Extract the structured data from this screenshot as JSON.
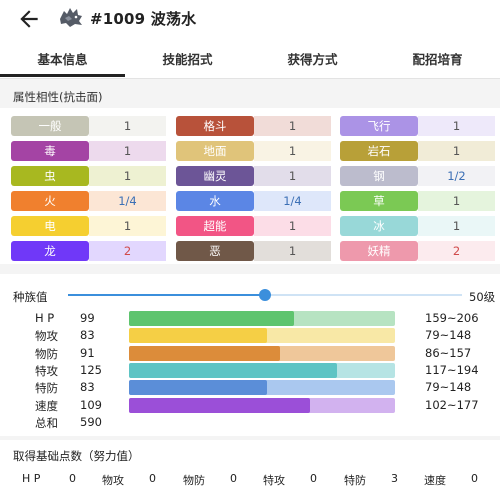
{
  "header": {
    "title": "#1009 波荡水"
  },
  "tabs": [
    {
      "label": "基本信息",
      "active": true
    },
    {
      "label": "技能招式",
      "active": false
    },
    {
      "label": "获得方式",
      "active": false
    },
    {
      "label": "配招培育",
      "active": false
    }
  ],
  "type_effectiveness": {
    "title": "属性相性(抗击面)",
    "items": [
      {
        "type": "一般",
        "mult": "1",
        "color": "#c5c5b5",
        "mult_color": "#555555"
      },
      {
        "type": "格斗",
        "mult": "1",
        "color": "#b8523a",
        "mult_color": "#555555"
      },
      {
        "type": "飞行",
        "mult": "1",
        "color": "#ab93e6",
        "mult_color": "#555555"
      },
      {
        "type": "毒",
        "mult": "1",
        "color": "#a444a4",
        "mult_color": "#555555"
      },
      {
        "type": "地面",
        "mult": "1",
        "color": "#e0c47a",
        "mult_color": "#555555"
      },
      {
        "type": "岩石",
        "mult": "1",
        "color": "#b8a038",
        "mult_color": "#555555"
      },
      {
        "type": "虫",
        "mult": "1",
        "color": "#a8b820",
        "mult_color": "#555555"
      },
      {
        "type": "幽灵",
        "mult": "1",
        "color": "#6c5597",
        "mult_color": "#555555"
      },
      {
        "type": "钢",
        "mult": "1/2",
        "color": "#bcbccd",
        "mult_color": "#3b6fb5"
      },
      {
        "type": "火",
        "mult": "1/4",
        "color": "#f0802e",
        "mult_color": "#3b6fb5"
      },
      {
        "type": "水",
        "mult": "1/4",
        "color": "#5b86e5",
        "mult_color": "#3b6fb5"
      },
      {
        "type": "草",
        "mult": "1",
        "color": "#7bc954",
        "mult_color": "#555555"
      },
      {
        "type": "电",
        "mult": "1",
        "color": "#f5cf30",
        "mult_color": "#555555"
      },
      {
        "type": "超能",
        "mult": "1",
        "color": "#f25585",
        "mult_color": "#555555"
      },
      {
        "type": "冰",
        "mult": "1",
        "color": "#98d8d8",
        "mult_color": "#555555"
      },
      {
        "type": "龙",
        "mult": "2",
        "color": "#7038f8",
        "mult_color": "#d04a4a"
      },
      {
        "type": "恶",
        "mult": "1",
        "color": "#705848",
        "mult_color": "#555555"
      },
      {
        "type": "妖精",
        "mult": "2",
        "color": "#ee99ac",
        "mult_color": "#d04a4a"
      }
    ]
  },
  "base_stats": {
    "label": "种族值",
    "level_label": "50级",
    "level_fraction": 0.5,
    "max_scale": 160,
    "rows": [
      {
        "name": "H P",
        "value": "99",
        "range": "159~206",
        "fill": "#5ec46e",
        "bg": "#b7e3c2"
      },
      {
        "name": "物攻",
        "value": "83",
        "range": "79~148",
        "fill": "#f5cf45",
        "bg": "#f8e8a6"
      },
      {
        "name": "物防",
        "value": "91",
        "range": "86~157",
        "fill": "#dc8c3a",
        "bg": "#efc79a"
      },
      {
        "name": "特攻",
        "value": "125",
        "range": "117~194",
        "fill": "#5ec4c4",
        "bg": "#b6e4e4"
      },
      {
        "name": "特防",
        "value": "83",
        "range": "79~148",
        "fill": "#5b8ed8",
        "bg": "#aac8ef"
      },
      {
        "name": "速度",
        "value": "109",
        "range": "102~177",
        "fill": "#9b4fd8",
        "bg": "#d2b2ef"
      }
    ],
    "total_label": "总和",
    "total_value": "590"
  },
  "ev_yield": {
    "title": "取得基础点数（努力值）",
    "items": [
      {
        "name": "H P",
        "value": "0"
      },
      {
        "name": "物攻",
        "value": "0"
      },
      {
        "name": "物防",
        "value": "0"
      },
      {
        "name": "特攻",
        "value": "0"
      },
      {
        "name": "特防",
        "value": "3"
      },
      {
        "name": "速度",
        "value": "0"
      }
    ]
  }
}
